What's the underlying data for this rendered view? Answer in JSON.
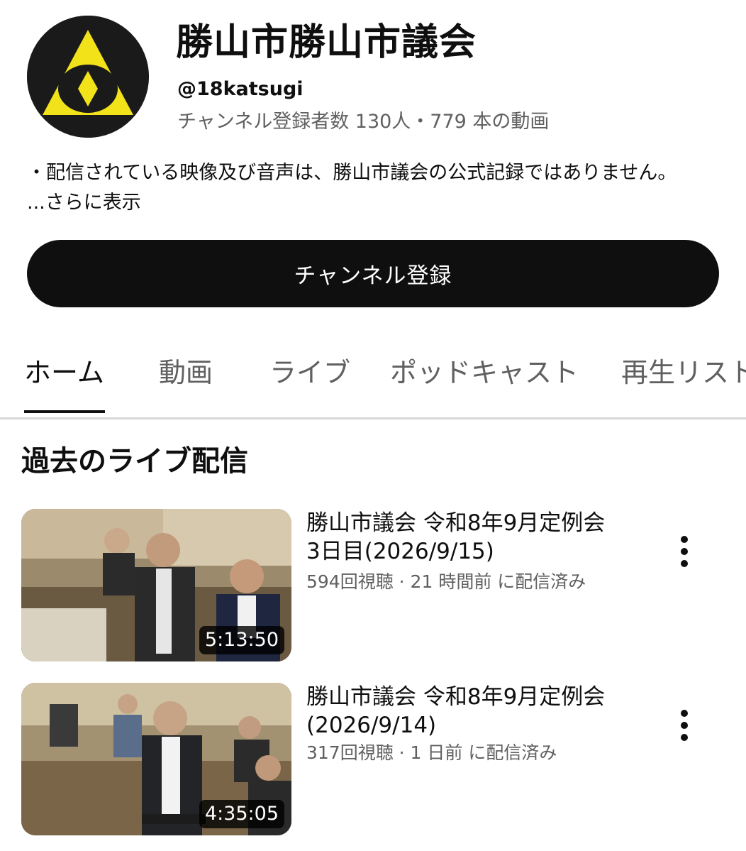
{
  "channel": {
    "name": "勝山市勝山市議会",
    "handle": "@18katsugi",
    "stats": "チャンネル登録者数 130人・779 本の動画",
    "description": "・配信されている映像及び音声は、勝山市議会の公式記録ではありません。",
    "more_label": "...さらに表示",
    "subscribe_label": "チャンネル登録"
  },
  "tabs": [
    {
      "label": "ホーム",
      "active": true
    },
    {
      "label": "動画"
    },
    {
      "label": "ライブ"
    },
    {
      "label": "ポッドキャスト"
    },
    {
      "label": "再生リスト"
    }
  ],
  "section": {
    "title": "過去のライブ配信"
  },
  "videos": [
    {
      "title_line1": "勝山市議会 令和8年9月定例会",
      "title_line2": "3日目(2026/9/15)",
      "meta": "594回視聴 · 21 時間前 に配信済み",
      "duration": "5:13:50"
    },
    {
      "title_line1": "勝山市議会 令和8年9月定例会",
      "title_line2": "(2026/9/14)",
      "meta": "317回視聴 · 1 日前 に配信済み",
      "duration": "4:35:05"
    }
  ],
  "colors": {
    "logo_yellow": "#f2e21a",
    "logo_bg": "#1a1a1a",
    "subscribe_bg": "#0f0f0f",
    "secondary_text": "#606060"
  }
}
